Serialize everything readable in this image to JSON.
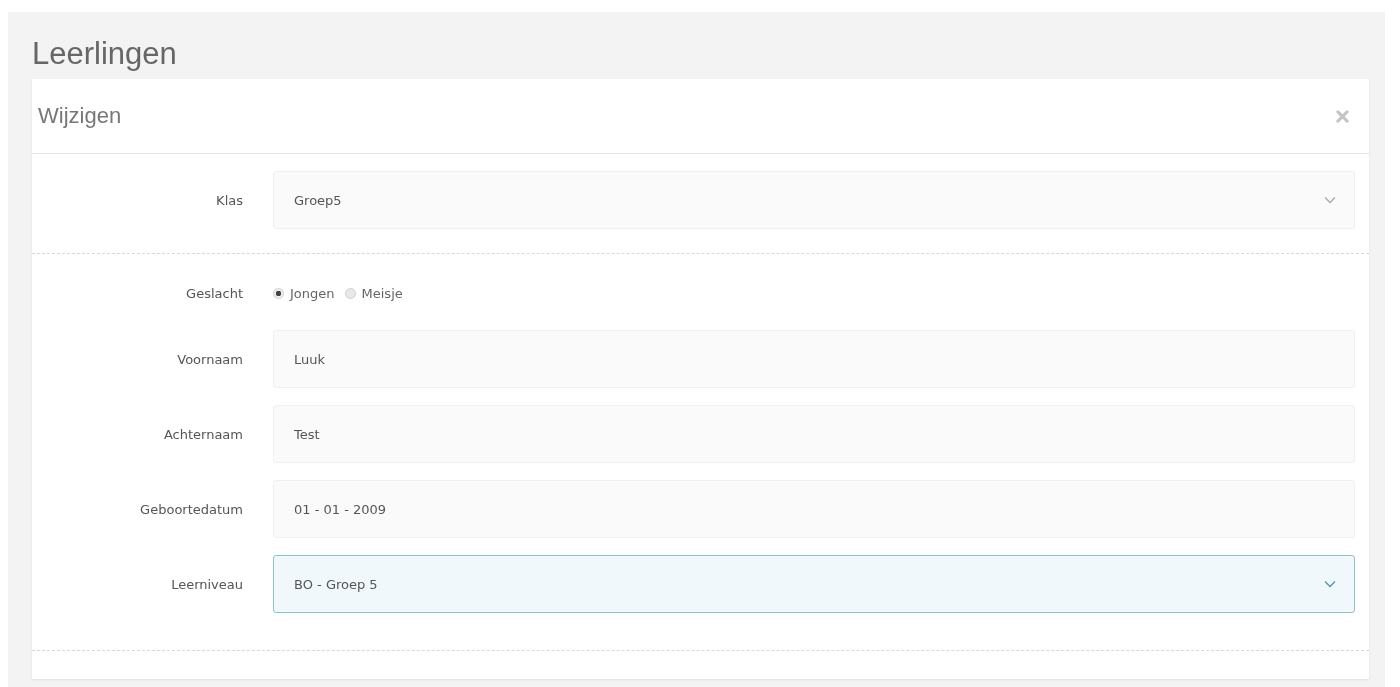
{
  "page_title": "Leerlingen",
  "panel": {
    "title": "Wijzigen",
    "top_fields": [
      {
        "kind": "select",
        "label": "Klas",
        "value": "Groep5",
        "focused": false
      }
    ],
    "fields": [
      {
        "kind": "radio",
        "label": "Geslacht",
        "options": [
          {
            "label": "Jongen",
            "selected": true
          },
          {
            "label": "Meisje",
            "selected": false
          }
        ]
      },
      {
        "kind": "text",
        "label": "Voornaam",
        "value": "Luuk",
        "focused": false
      },
      {
        "kind": "text",
        "label": "Achternaam",
        "value": "Test",
        "focused": false
      },
      {
        "kind": "text",
        "label": "Geboortedatum",
        "value": "01 - 01 - 2009",
        "focused": false
      },
      {
        "kind": "select",
        "label": "Leerniveau",
        "value": "BO - Groep 5",
        "focused": true
      }
    ]
  }
}
